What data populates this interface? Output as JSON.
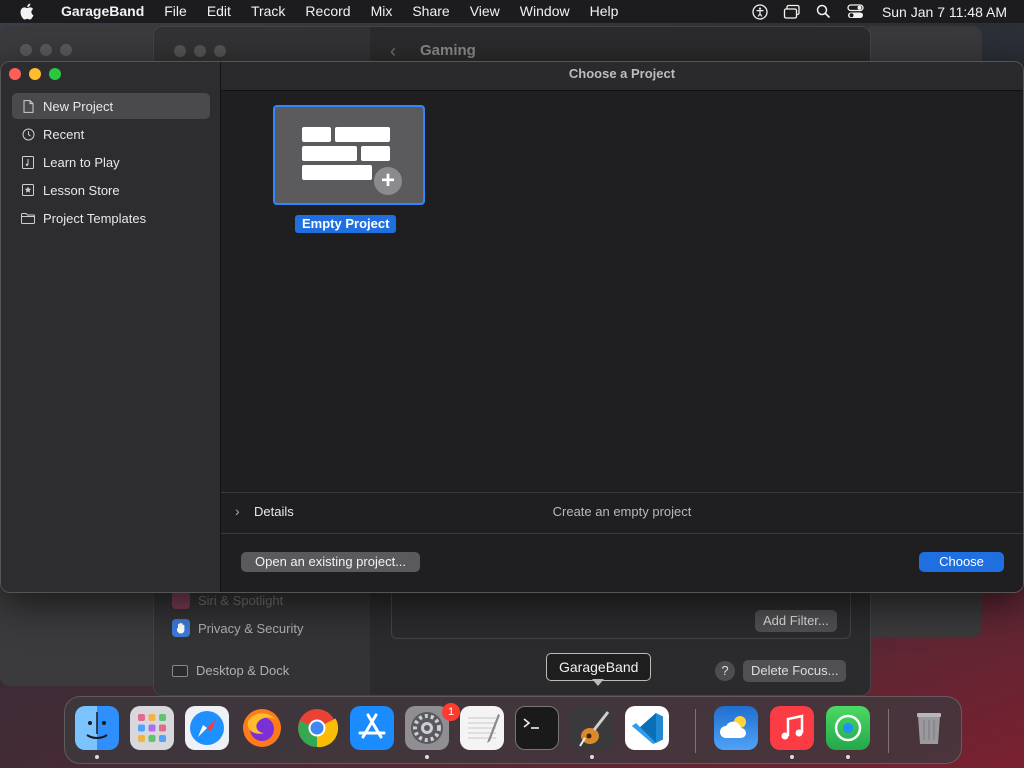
{
  "menubar": {
    "app_name": "GarageBand",
    "items": [
      "File",
      "Edit",
      "Track",
      "Record",
      "Mix",
      "Share",
      "View",
      "Window",
      "Help"
    ],
    "clock": "Sun Jan 7  11:48 AM",
    "status_icons": [
      "accessibility-icon",
      "screen-mirroring-icon",
      "search-icon",
      "control-center-icon"
    ]
  },
  "background": {
    "settings_title": "Gaming",
    "settings_items": [
      "Siri & Spotlight",
      "Privacy & Security",
      "Desktop & Dock"
    ],
    "add_filter": "Add Filter...",
    "help": "?",
    "delete_focus": "Delete Focus..."
  },
  "window": {
    "title": "Choose a Project",
    "sidebar": [
      {
        "label": "New Project",
        "icon": "document-icon",
        "selected": true
      },
      {
        "label": "Recent",
        "icon": "clock-icon",
        "selected": false
      },
      {
        "label": "Learn to Play",
        "icon": "music-note-icon",
        "selected": false
      },
      {
        "label": "Lesson Store",
        "icon": "star-icon",
        "selected": false
      },
      {
        "label": "Project Templates",
        "icon": "folder-icon",
        "selected": false
      }
    ],
    "template": {
      "label": "Empty Project"
    },
    "details": {
      "label": "Details",
      "description": "Create an empty project"
    },
    "open_button": "Open an existing project...",
    "choose_button": "Choose"
  },
  "dock": {
    "tooltip": "GarageBand",
    "apps": [
      {
        "name": "Finder",
        "icon": "finder-icon",
        "color": "#2f8fff"
      },
      {
        "name": "Launchpad",
        "icon": "launchpad-icon",
        "color": "#d8d8dc"
      },
      {
        "name": "Safari",
        "icon": "safari-icon",
        "color": "#1e90ff"
      },
      {
        "name": "Firefox",
        "icon": "firefox-icon",
        "color": "#ff7a1a"
      },
      {
        "name": "Chrome",
        "icon": "chrome-icon",
        "color": "#ffffff"
      },
      {
        "name": "App Store",
        "icon": "app-store-icon",
        "color": "#1a8cff"
      },
      {
        "name": "System Settings",
        "icon": "settings-icon",
        "color": "#8e8e93",
        "badge": "1"
      },
      {
        "name": "TextEdit",
        "icon": "textedit-icon",
        "color": "#f4f4f4"
      },
      {
        "name": "Terminal",
        "icon": "terminal-icon",
        "color": "#1a1a1a"
      },
      {
        "name": "GarageBand",
        "icon": "garageband-icon",
        "color": "#3a3a3c"
      },
      {
        "name": "VS Code",
        "icon": "vscode-icon",
        "color": "#ffffff"
      },
      {
        "name": "Weather",
        "icon": "weather-icon",
        "color": "#2a7fe0"
      },
      {
        "name": "Music",
        "icon": "music-icon",
        "color": "#fc3c44"
      },
      {
        "name": "Find My",
        "icon": "find-my-icon",
        "color": "#34c759"
      },
      {
        "name": "Trash",
        "icon": "trash-icon",
        "color": "#9a9a9e"
      }
    ]
  }
}
